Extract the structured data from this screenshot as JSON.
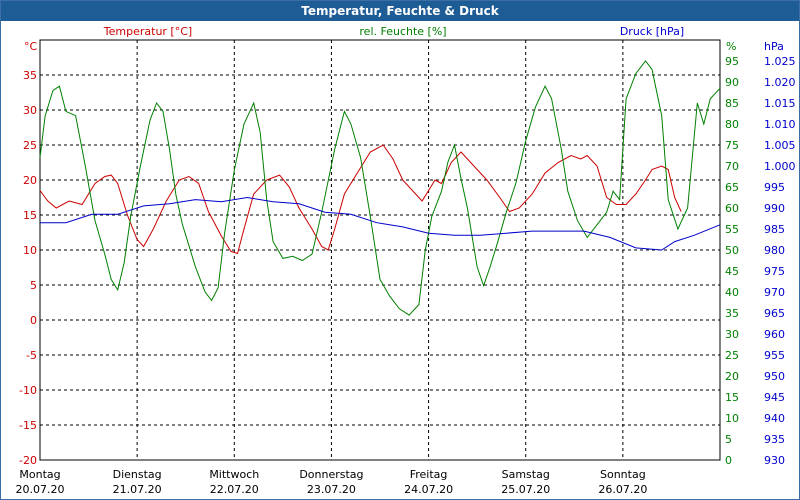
{
  "window": {
    "title": "Temperatur, Feuchte & Druck"
  },
  "chart_data": {
    "type": "line",
    "title": "Temperatur, Feuchte & Druck",
    "legend": {
      "temperature": "Temperatur [°C]",
      "humidity": "rel. Feuchte [%]",
      "pressure": "Druck [hPa]"
    },
    "axes": {
      "left": {
        "unit": "°C",
        "min": -20,
        "max": 40,
        "ticks": [
          -20,
          -15,
          -10,
          -5,
          0,
          5,
          10,
          15,
          20,
          25,
          30,
          35
        ]
      },
      "mid": {
        "unit": "%",
        "min": 0,
        "max": 100,
        "ticks": [
          0,
          5,
          10,
          15,
          20,
          25,
          30,
          35,
          40,
          45,
          50,
          55,
          60,
          65,
          70,
          75,
          80,
          85,
          90,
          95
        ]
      },
      "right": {
        "unit": "hPa",
        "min": 930,
        "max": 1030,
        "ticks": [
          "930",
          "935",
          "940",
          "945",
          "950",
          "955",
          "960",
          "965",
          "970",
          "975",
          "980",
          "985",
          "990",
          "995",
          "1.000",
          "1.005",
          "1.010",
          "1.015",
          "1.020",
          "1.025"
        ]
      }
    },
    "grid": true,
    "x_days": [
      {
        "day": "Montag",
        "date": "20.07.20"
      },
      {
        "day": "Dienstag",
        "date": "21.07.20"
      },
      {
        "day": "Mittwoch",
        "date": "22.07.20"
      },
      {
        "day": "Donnerstag",
        "date": "23.07.20"
      },
      {
        "day": "Freitag",
        "date": "24.07.20"
      },
      {
        "day": "Samstag",
        "date": "25.07.20"
      },
      {
        "day": "Sonntag",
        "date": "26.07.20"
      }
    ],
    "x_range": [
      0,
      7
    ],
    "series": [
      {
        "key": "temperature",
        "name": "Temperatur [°C]",
        "axis": "left",
        "color": "#cc0000",
        "points": [
          [
            0.0,
            18.5
          ],
          [
            0.12,
            17.0
          ],
          [
            0.25,
            16.0
          ],
          [
            0.45,
            17.0
          ],
          [
            0.65,
            16.5
          ],
          [
            0.85,
            19.5
          ],
          [
            1.0,
            20.5
          ],
          [
            1.1,
            20.7
          ],
          [
            1.2,
            19.5
          ],
          [
            1.35,
            15.0
          ],
          [
            1.5,
            11.5
          ],
          [
            1.6,
            10.5
          ],
          [
            1.75,
            13.0
          ],
          [
            1.95,
            17.0
          ],
          [
            2.15,
            20.0
          ],
          [
            2.3,
            20.5
          ],
          [
            2.45,
            19.5
          ],
          [
            2.6,
            15.5
          ],
          [
            2.8,
            12.0
          ],
          [
            2.95,
            9.8
          ],
          [
            3.05,
            9.5
          ],
          [
            3.15,
            13.0
          ],
          [
            3.3,
            18.0
          ],
          [
            3.5,
            20.0
          ],
          [
            3.7,
            20.7
          ],
          [
            3.85,
            19.0
          ],
          [
            4.0,
            16.0
          ],
          [
            4.2,
            13.0
          ],
          [
            4.35,
            10.5
          ],
          [
            4.45,
            10.0
          ],
          [
            4.55,
            13.0
          ],
          [
            4.7,
            18.0
          ],
          [
            4.9,
            21.0
          ],
          [
            5.1,
            24.0
          ],
          [
            5.3,
            25.0
          ],
          [
            5.45,
            23.0
          ],
          [
            5.6,
            20.0
          ],
          [
            5.8,
            18.0
          ],
          [
            5.9,
            17.0
          ],
          [
            6.0,
            18.5
          ],
          [
            6.1,
            20.0
          ],
          [
            6.2,
            19.5
          ],
          [
            6.35,
            22.5
          ],
          [
            6.5,
            24.0
          ],
          [
            6.7,
            22.0
          ],
          [
            6.9,
            20.0
          ],
          [
            7.1,
            17.5
          ],
          [
            7.25,
            15.5
          ],
          [
            7.4,
            16.0
          ],
          [
            7.6,
            18.0
          ],
          [
            7.8,
            21.0
          ],
          [
            8.0,
            22.5
          ],
          [
            8.2,
            23.5
          ],
          [
            8.35,
            23.0
          ],
          [
            8.45,
            23.5
          ],
          [
            8.6,
            22.0
          ],
          [
            8.75,
            17.5
          ],
          [
            8.9,
            16.5
          ],
          [
            9.05,
            16.5
          ],
          [
            9.2,
            18.0
          ],
          [
            9.35,
            20.0
          ],
          [
            9.45,
            21.5
          ],
          [
            9.6,
            22.0
          ],
          [
            9.7,
            21.5
          ],
          [
            9.8,
            17.5
          ],
          [
            9.9,
            15.5
          ]
        ]
      },
      {
        "key": "humidity",
        "name": "rel. Feuchte [%]",
        "axis": "mid",
        "color": "#008000",
        "points": [
          [
            0.0,
            72.0
          ],
          [
            0.08,
            82.0
          ],
          [
            0.2,
            88.0
          ],
          [
            0.3,
            89.0
          ],
          [
            0.4,
            83.0
          ],
          [
            0.55,
            82.0
          ],
          [
            0.7,
            70.0
          ],
          [
            0.85,
            57.0
          ],
          [
            1.0,
            49.0
          ],
          [
            1.1,
            43.0
          ],
          [
            1.2,
            40.5
          ],
          [
            1.3,
            47.0
          ],
          [
            1.4,
            58.0
          ],
          [
            1.55,
            70.0
          ],
          [
            1.7,
            81.0
          ],
          [
            1.8,
            85.0
          ],
          [
            1.9,
            83.0
          ],
          [
            2.0,
            74.0
          ],
          [
            2.1,
            63.0
          ],
          [
            2.2,
            56.0
          ],
          [
            2.3,
            51.0
          ],
          [
            2.4,
            46.0
          ],
          [
            2.55,
            40.0
          ],
          [
            2.65,
            38.0
          ],
          [
            2.75,
            41.0
          ],
          [
            2.85,
            54.0
          ],
          [
            3.0,
            69.0
          ],
          [
            3.15,
            80.0
          ],
          [
            3.3,
            85.0
          ],
          [
            3.4,
            78.0
          ],
          [
            3.5,
            62.0
          ],
          [
            3.6,
            52.0
          ],
          [
            3.75,
            48.0
          ],
          [
            3.9,
            48.5
          ],
          [
            4.05,
            47.5
          ],
          [
            4.2,
            49.0
          ],
          [
            4.35,
            59.0
          ],
          [
            4.55,
            74.0
          ],
          [
            4.7,
            83.0
          ],
          [
            4.8,
            80.0
          ],
          [
            4.95,
            72.0
          ],
          [
            5.1,
            58.0
          ],
          [
            5.25,
            43.0
          ],
          [
            5.4,
            39.0
          ],
          [
            5.55,
            36.0
          ],
          [
            5.7,
            34.5
          ],
          [
            5.85,
            37.0
          ],
          [
            5.95,
            50.0
          ],
          [
            6.05,
            58.0
          ],
          [
            6.2,
            64.0
          ],
          [
            6.3,
            71.0
          ],
          [
            6.4,
            75.0
          ],
          [
            6.5,
            67.0
          ],
          [
            6.6,
            60.0
          ],
          [
            6.75,
            46.0
          ],
          [
            6.85,
            41.5
          ],
          [
            6.95,
            46.0
          ],
          [
            7.05,
            51.0
          ],
          [
            7.2,
            59.0
          ],
          [
            7.35,
            66.0
          ],
          [
            7.5,
            76.0
          ],
          [
            7.65,
            84.0
          ],
          [
            7.8,
            89.0
          ],
          [
            7.9,
            86.0
          ],
          [
            8.05,
            74.0
          ],
          [
            8.15,
            64.0
          ],
          [
            8.3,
            57.0
          ],
          [
            8.45,
            53.0
          ],
          [
            8.6,
            56.0
          ],
          [
            8.75,
            59.0
          ],
          [
            8.85,
            64.0
          ],
          [
            8.95,
            62.0
          ],
          [
            9.05,
            86.0
          ],
          [
            9.2,
            92.0
          ],
          [
            9.35,
            95.0
          ],
          [
            9.45,
            93.0
          ],
          [
            9.6,
            82.0
          ],
          [
            9.7,
            62.0
          ],
          [
            9.85,
            55.0
          ],
          [
            10.0,
            60.0
          ],
          [
            10.15,
            85.0
          ],
          [
            10.25,
            80.0
          ],
          [
            10.35,
            86.0
          ],
          [
            10.5,
            88.5
          ]
        ]
      },
      {
        "key": "pressure",
        "name": "Druck [hPa]",
        "axis": "right",
        "color": "#0000cc",
        "points": [
          [
            0.0,
            986.5
          ],
          [
            0.4,
            986.5
          ],
          [
            0.8,
            988.5
          ],
          [
            1.2,
            988.5
          ],
          [
            1.6,
            990.5
          ],
          [
            2.0,
            991.0
          ],
          [
            2.4,
            992.0
          ],
          [
            2.8,
            991.5
          ],
          [
            3.2,
            992.5
          ],
          [
            3.6,
            991.5
          ],
          [
            4.0,
            991.0
          ],
          [
            4.4,
            989.0
          ],
          [
            4.8,
            988.5
          ],
          [
            5.2,
            986.5
          ],
          [
            5.6,
            985.5
          ],
          [
            6.0,
            984.0
          ],
          [
            6.4,
            983.5
          ],
          [
            6.8,
            983.5
          ],
          [
            7.2,
            984.0
          ],
          [
            7.6,
            984.5
          ],
          [
            8.0,
            984.5
          ],
          [
            8.4,
            984.5
          ],
          [
            8.8,
            983.0
          ],
          [
            9.2,
            980.5
          ],
          [
            9.6,
            980.0
          ],
          [
            9.8,
            982.0
          ],
          [
            10.1,
            983.5
          ],
          [
            10.5,
            986.0
          ]
        ]
      }
    ]
  }
}
